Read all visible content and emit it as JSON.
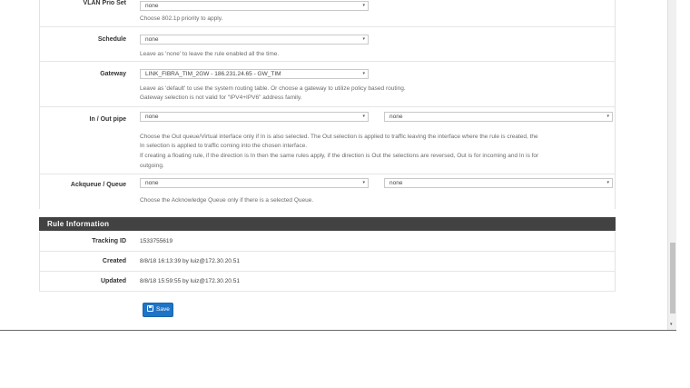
{
  "vlan": {
    "label": "VLAN Prio Set",
    "value": "none",
    "help": "Choose 802.1p priority to apply."
  },
  "schedule": {
    "label": "Schedule",
    "value": "none",
    "help": "Leave as 'none' to leave the rule enabled all the time."
  },
  "gateway": {
    "label": "Gateway",
    "value": "LINK_FIBRA_TIM_2GW - 186.231.24.65 - GW_TIM",
    "help1": "Leave as 'default' to use the system routing table. Or choose a gateway to utilize policy based routing.",
    "help2": "Gateway selection is not valid for \"IPV4+IPV6\" address family."
  },
  "inout": {
    "label": "In / Out pipe",
    "in_value": "none",
    "out_value": "none",
    "help1": "Choose the Out queue/Virtual interface only if In is also selected. The Out selection is applied to traffic leaving the interface where the rule is created, the",
    "help2": "In selection is applied to traffic coming into the chosen interface.",
    "help3": "If creating a floating rule, if the direction is In then the same rules apply, if the direction is Out the selections are reversed, Out is for incoming and In is for",
    "help4": "outgoing."
  },
  "ackqueue": {
    "label": "Ackqueue / Queue",
    "ack_value": "none",
    "queue_value": "none",
    "help": "Choose the Acknowledge Queue only if there is a selected Queue."
  },
  "rule_info": {
    "header": "Rule Information",
    "tracking_label": "Tracking ID",
    "tracking_value": "1533755619",
    "created_label": "Created",
    "created_value": "8/8/18 16:13:39 by luiz@172.30.20.51",
    "updated_label": "Updated",
    "updated_value": "8/8/18 15:59:55 by luiz@172.30.20.51"
  },
  "save_label": "Save",
  "icons": {
    "caret": "▾",
    "scroll_down": "▾"
  }
}
